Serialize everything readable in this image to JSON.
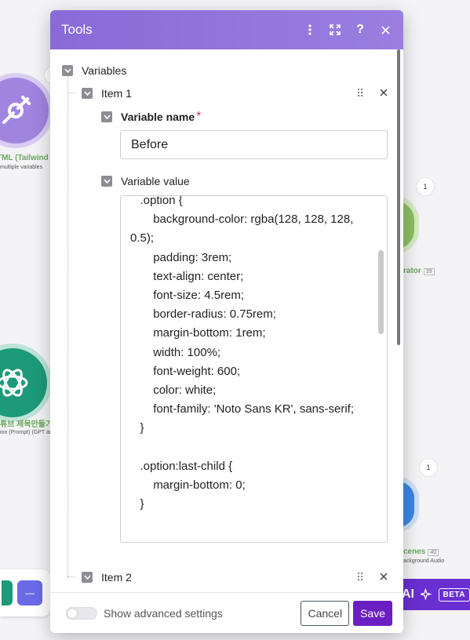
{
  "background": {
    "node_tools": {
      "label": "TML (Tailwind",
      "sub": "multiple variables",
      "icon": "tools-icon",
      "color": "#a184e0"
    },
    "node_gpt": {
      "label": "튜브 제목만들기",
      "sub": "ion (Prompt) (GPT and",
      "icon": "openai-icon",
      "color": "#1c9a79"
    },
    "node_right_green": {
      "label": "rator",
      "badge": "39",
      "bubble": "1",
      "color": "#8cc163"
    },
    "node_right_blue": {
      "label": "cenes",
      "badge": "40",
      "sub": "ackground Audio",
      "bubble": "1",
      "color": "#3b86e6"
    },
    "ai_bar": {
      "text": "AI",
      "beta": "BETA",
      "color": "#6a2fd1"
    },
    "bottom_bar_button": "—"
  },
  "dialog": {
    "title": "Tools",
    "header_color": "#8a6ad8",
    "root_label": "Variables",
    "items": [
      {
        "label": "Item 1",
        "name_label": "Variable name",
        "required_mark": "*",
        "name_value": "Before",
        "value_label": "Variable value",
        "value_text": "   .option {\n       background-color: rgba(128, 128, 128, 0.5);\n       padding: 3rem;\n       text-align: center;\n       font-size: 4.5rem;\n       border-radius: 0.75rem;\n       margin-bottom: 1rem;\n       width: 100%;\n       font-weight: 600;\n       color: white;\n       font-family: 'Noto Sans KR', sans-serif;\n   }\n\n   .option:last-child {\n       margin-bottom: 0;\n   }"
      },
      {
        "label": "Item 2"
      }
    ],
    "footer": {
      "advanced_label": "Show advanced settings",
      "advanced_enabled": false,
      "cancel_label": "Cancel",
      "save_label": "Save",
      "save_color": "#6a1fc2"
    }
  }
}
